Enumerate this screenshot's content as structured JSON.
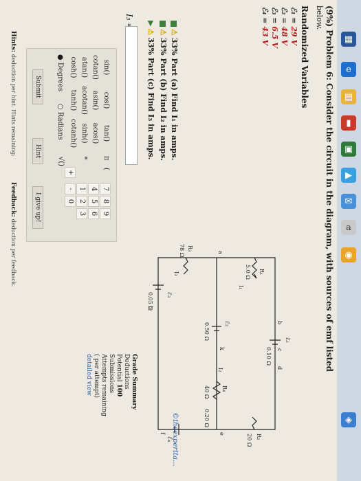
{
  "problem": {
    "title": "(9%) Problem 6: Consider the circuit in the diagram, with sources of emf listed",
    "title_cont": "below.",
    "randomized_heading": "Randomized Variables",
    "variables": [
      {
        "sym": "ℰ₁ =",
        "val": "29 V"
      },
      {
        "sym": "ℰ₂ =",
        "val": "48 V"
      },
      {
        "sym": "ℰ₃ =",
        "val": "6.5 V"
      },
      {
        "sym": "ℰ₄ =",
        "val": "43 V"
      }
    ],
    "parts": [
      {
        "label": "33% Part (a) Find I₁ in amps."
      },
      {
        "label": "33% Part (b) Find I₂ in amps."
      },
      {
        "label": "33% Part (c) Find I₃ in amps."
      }
    ],
    "answer_label": "I₃ ="
  },
  "keypad": {
    "functions": [
      [
        "sin()",
        "cos()",
        "tan()"
      ],
      [
        "cotan()",
        "asin()",
        "acos()"
      ],
      [
        "atan()",
        "acotan()",
        "sinh()"
      ],
      [
        "cosh()",
        "tanh()",
        "cotanh()"
      ]
    ],
    "symbols": [
      "π",
      "(",
      "",
      "",
      ""
    ],
    "numbers": [
      [
        "7",
        "8",
        "9"
      ],
      [
        "4",
        "5",
        "6"
      ],
      [
        "1",
        "2",
        "3"
      ],
      [
        "+",
        "-",
        "0"
      ]
    ],
    "extra": [
      "*",
      "√()"
    ],
    "degrees": "Degrees",
    "radians": "Radians",
    "submit": "Submit",
    "hint": "Hint",
    "giveup": "I give up!",
    "feedback_label": "Feedback:",
    "feedback_note": "deduction per feedback.",
    "hints_label": "Hints:",
    "hints_note": "deduction per hint. Hints remaining:"
  },
  "circuit": {
    "labels": [
      "ℰ₁",
      "0.10 Ω",
      "R₁",
      "5.0 Ω",
      "I₁",
      "ℰ₂",
      "R₂",
      "20 Ω",
      "0.50 Ω",
      "R₄",
      "40 Ω",
      "0.20 Ω",
      "R₃",
      "78 Ω",
      "I₃",
      "ℰ₃",
      "0.05 Ω",
      "ℰ₄",
      "b",
      "c",
      "d",
      "e",
      "f",
      "k",
      "h",
      "a",
      "I₂"
    ]
  },
  "grade": {
    "heading": "Grade Summary",
    "deductions": "Deductions",
    "potential": "Potential",
    "potential_val": "100",
    "submissions": "Submissions",
    "attempts": "Attempts remaining",
    "per_attempt": "(   per attempt)",
    "detailed": "detailed view"
  },
  "brand": "©theexpertta..."
}
